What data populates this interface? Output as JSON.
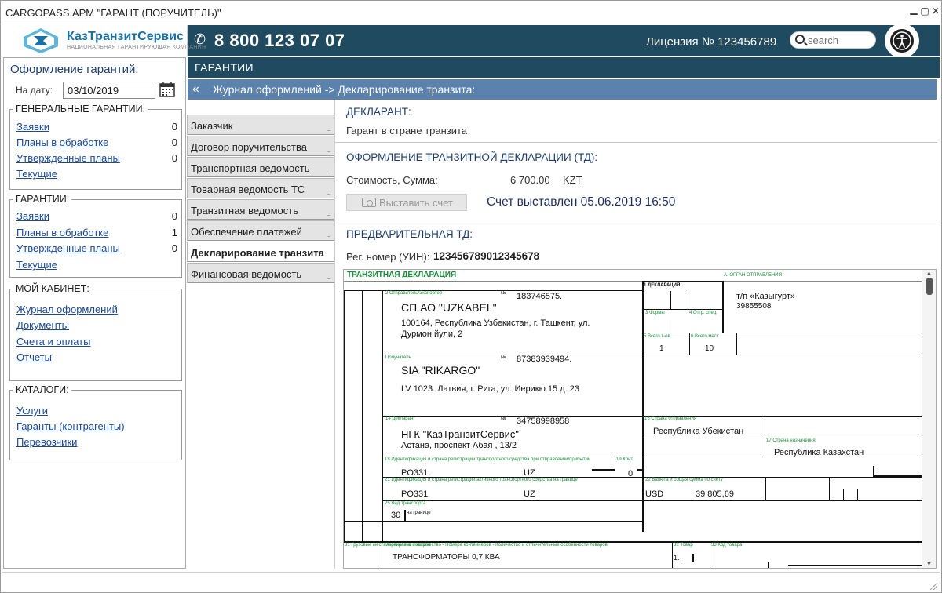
{
  "window": {
    "title": "CARGOPASS АРМ \"ГАРАНТ (ПОРУЧИТЕЛЬ)\""
  },
  "header": {
    "brand": "КазТранзитСервис",
    "tagline": "НАЦИОНАЛЬНАЯ ГАРАНТИРУЮЩАЯ КОМПАНИЯ",
    "phone": "8 800 123 07 07",
    "license": "Лицензия № 123456789",
    "search_placeholder": "search",
    "colors": {
      "bar": "#1f4a5f",
      "brand": "#1a6fa3"
    }
  },
  "sidebar": {
    "heading": "Оформление гарантий:",
    "date_label": "На дату:",
    "date_value": "03/10/2019",
    "general": {
      "legend": "ГЕНЕРАЛЬНЫЕ ГАРАНТИИ:",
      "items": [
        {
          "label": "Заявки",
          "count": "0"
        },
        {
          "label": "Планы в обработке",
          "count": "0"
        },
        {
          "label": "Утвержденные планы",
          "count": "0"
        },
        {
          "label": "Текущие",
          "count": ""
        }
      ]
    },
    "guarantees": {
      "legend": "ГАРАНТИИ:",
      "items": [
        {
          "label": "Заявки",
          "count": "0"
        },
        {
          "label": "Планы в обработке",
          "count": "1"
        },
        {
          "label": "Утвержденные планы",
          "count": "0"
        },
        {
          "label": "Текущие",
          "count": ""
        }
      ]
    },
    "cabinet": {
      "legend": "МОЙ КАБИНЕТ:",
      "items": [
        {
          "label": "Журнал оформлений"
        },
        {
          "label": "Документы"
        },
        {
          "label": "Счета и оплаты"
        },
        {
          "label": "Отчеты"
        }
      ]
    },
    "catalogs": {
      "legend": "КАТАЛОГИ:",
      "items": [
        {
          "label": "Услуги"
        },
        {
          "label": "Гаранты (контрагенты)"
        },
        {
          "label": "Перевозчики"
        }
      ]
    }
  },
  "section": {
    "title": "ГАРАНТИИ",
    "breadcrumb": "Журнал оформлений -> Декларирование транзита:"
  },
  "tabs": [
    {
      "label": "Заказчик",
      "active": false
    },
    {
      "label": "Договор поручительства",
      "active": false
    },
    {
      "label": "Транспортная ведомость",
      "active": false
    },
    {
      "label": "Товарная ведомость ТС",
      "active": false
    },
    {
      "label": "Транзитная ведомость",
      "active": false
    },
    {
      "label": "Обеспечение платежей",
      "active": false
    },
    {
      "label": "Декларирование транзита",
      "active": true
    },
    {
      "label": "Финансовая ведомость",
      "active": false
    }
  ],
  "main": {
    "declarant_title": "ДЕКЛАРАНТ:",
    "declarant_value": "Гарант в стране транзита",
    "td_title": "ОФОРМЛЕНИЕ ТРАНЗИТНОЙ ДЕКЛАРАЦИИ (ТД):",
    "cost_label": "Стоимость, Сумма:",
    "cost_value": "6 700.00",
    "currency": "KZT",
    "invoice_button": "Выставить счет",
    "invoice_status": "Счет выставлен 05.06.2019 16:50",
    "prelim_title": "ПРЕДВАРИТЕЛЬНАЯ ТД:",
    "reg_label": "Рег. номер (УИН):",
    "reg_value": "123456789012345678"
  },
  "declaration": {
    "title": "ТРАНЗИТНАЯ ДЕКЛАРАЦИЯ",
    "box_a": "А. ОРГАН ОТПРАВЛЕНИЯ",
    "box1": "1 ДЕКЛАРАЦИЯ",
    "box2": "2 Отправитель/Экспортер",
    "box3": "3 Формы",
    "box4": "4 Отгр. спец.",
    "box5": "5 Всего т-ов",
    "box6": "6 Всего мест",
    "box8": "Получатель",
    "box14": "14 Декларант",
    "box15": "15 Страна отправления",
    "box17": "17 Страна назначения",
    "box18": "18 Идентификация и страна регистрации транспортного средства при отправлении/прибытии",
    "box19": "19 Конт.",
    "box21": "21 Идентификация и страна регистрации активного транспортного средства на границе",
    "box22": "22 Валюта и общая сумма по счету",
    "box25": "25 Вид транспорта",
    "box25b": "на границе",
    "box31": "31 Грузовые места и описание товаров",
    "box31b": "Маркировка и количество - Номера контейнеров - Количество и отличительные особенности товаров",
    "box32": "32 Товар",
    "box33": "33 Код товара",
    "no_label": "№",
    "sender_no": "183746575.",
    "sender_name": "СП АО \"UZKABEL\"",
    "sender_addr1": "100164, Республика Узбекистан, г. Ташкент, ул.",
    "sender_addr2": "Дурмон йули, 2",
    "office": "т/п «Казыгурт»",
    "office_code": "39855508",
    "total_items": "1",
    "total_places": "10",
    "recv_no": "87383939494.",
    "recv_name": "SIA \"RIKARGO\"",
    "recv_addr": "LV 1023. Латвия, г. Рига, ул. Иерикю 15 д. 23",
    "decl_no": "34758998958",
    "decl_name": "НГК \"КазТранзитСервис\"",
    "decl_addr": "Астана, проспект Абая , 13/2",
    "country_from": "Республика Убекистан",
    "country_to": "Республика Казахстан",
    "vehicle1": "PO331",
    "vehicle1_country": "UZ",
    "cont": "0",
    "vehicle2": "PO331",
    "vehicle2_country": "UZ",
    "currency": "USD",
    "amount": "39 805,69",
    "transport_mode": "30",
    "goods": "ТРАНСФОРМАТОРЫ 0,7 КВА",
    "goods_no": "1."
  }
}
